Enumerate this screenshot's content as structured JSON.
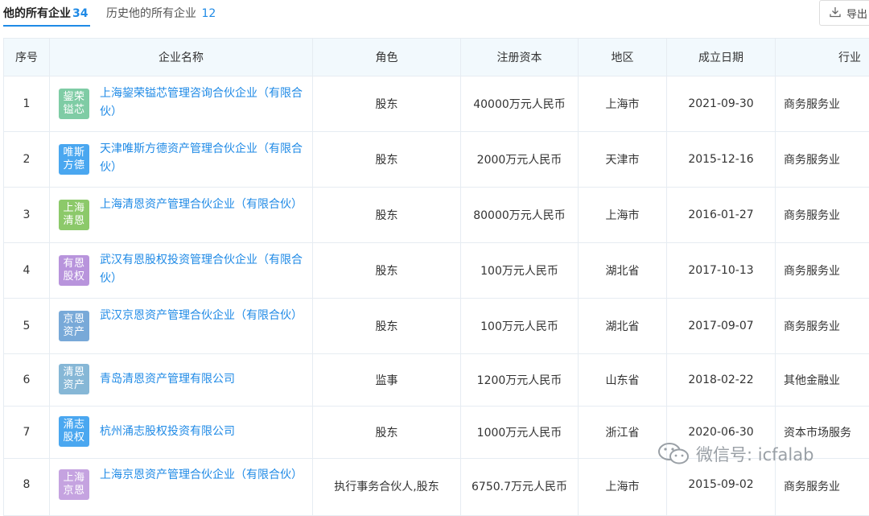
{
  "tabs": {
    "current_label": "他的所有企业",
    "current_count": "34",
    "history_label": "历史他的所有企业",
    "history_count": "12"
  },
  "toolbar": {
    "export_label": "导出"
  },
  "table": {
    "headers": {
      "index": "序号",
      "name": "企业名称",
      "role": "角色",
      "capital": "注册资本",
      "region": "地区",
      "date": "成立日期",
      "industry": "行业"
    },
    "rows": [
      {
        "index": "1",
        "logo_line1": "鋆荣",
        "logo_line2": "镒芯",
        "logo_color": "#7fcca5",
        "name": "上海鋆荣镒芯管理咨询合伙企业（有限合伙）",
        "role": "股东",
        "capital": "40000万元人民币",
        "region": "上海市",
        "date": "2021-09-30",
        "industry": "商务服务业"
      },
      {
        "index": "2",
        "logo_line1": "唯斯",
        "logo_line2": "方德",
        "logo_color": "#4aa7f0",
        "name": "天津唯斯方德资产管理合伙企业（有限合伙）",
        "role": "股东",
        "capital": "2000万元人民币",
        "region": "天津市",
        "date": "2015-12-16",
        "industry": "商务服务业"
      },
      {
        "index": "3",
        "logo_line1": "上海",
        "logo_line2": "清恩",
        "logo_color": "#8cc96a",
        "name": "上海清恩资产管理合伙企业（有限合伙）",
        "role": "股东",
        "capital": "80000万元人民币",
        "region": "上海市",
        "date": "2016-01-27",
        "industry": "商务服务业"
      },
      {
        "index": "4",
        "logo_line1": "有恩",
        "logo_line2": "股权",
        "logo_color": "#b894dc",
        "name": "武汉有恩股权投资管理合伙企业（有限合伙）",
        "role": "股东",
        "capital": "100万元人民币",
        "region": "湖北省",
        "date": "2017-10-13",
        "industry": "商务服务业"
      },
      {
        "index": "5",
        "logo_line1": "京恩",
        "logo_line2": "资产",
        "logo_color": "#78a9d8",
        "name": "武汉京恩资产管理合伙企业（有限合伙）",
        "role": "股东",
        "capital": "100万元人民币",
        "region": "湖北省",
        "date": "2017-09-07",
        "industry": "商务服务业"
      },
      {
        "index": "6",
        "logo_line1": "清恩",
        "logo_line2": "资产",
        "logo_color": "#86b7d6",
        "name": "青岛清恩资产管理有限公司",
        "role": "监事",
        "capital": "1200万元人民币",
        "region": "山东省",
        "date": "2018-02-22",
        "industry": "其他金融业"
      },
      {
        "index": "7",
        "logo_line1": "涌志",
        "logo_line2": "股权",
        "logo_color": "#4aa7f0",
        "name": "杭州涌志股权投资有限公司",
        "role": "股东",
        "capital": "1000万元人民币",
        "region": "浙江省",
        "date": "2020-06-30",
        "industry": "资本市场服务"
      },
      {
        "index": "8",
        "logo_line1": "上海",
        "logo_line2": "京恩",
        "logo_color": "#c5a3e0",
        "name": "上海京恩资产管理合伙企业（有限合伙）",
        "role": "执行事务合伙人,股东",
        "capital": "6750.7万元人民币",
        "region": "上海市",
        "date": "2015-09-02",
        "industry": "商务服务业"
      }
    ]
  },
  "watermark": {
    "text": "微信号: icfalab"
  }
}
